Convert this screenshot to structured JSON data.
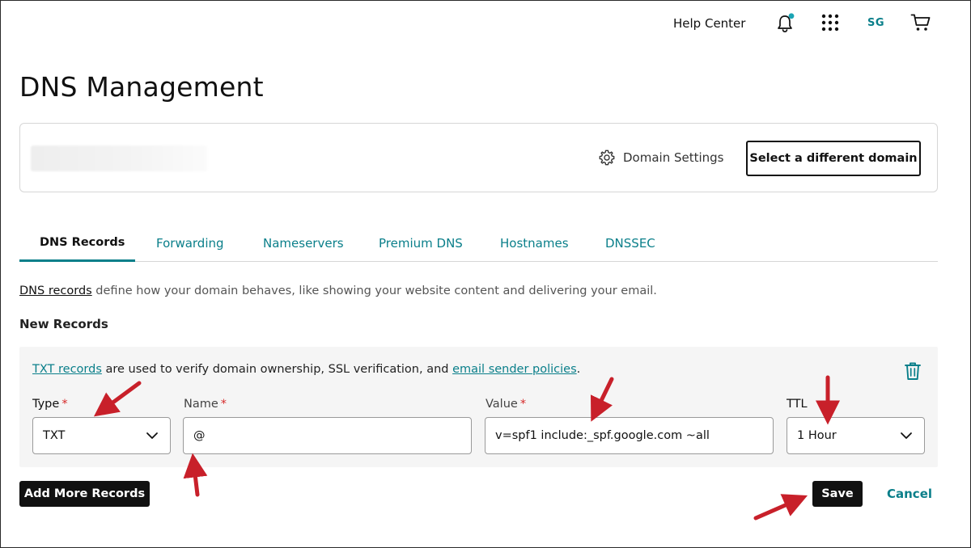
{
  "header": {
    "help_center": "Help Center",
    "user_initials": "SG",
    "icons": [
      "bell-icon",
      "apps-grid-icon",
      "cart-icon"
    ]
  },
  "page": {
    "title": "DNS Management"
  },
  "domain_card": {
    "domain_settings_label": "Domain Settings",
    "select_domain_label": "Select a different domain"
  },
  "tabs": [
    {
      "label": "DNS Records",
      "active": true
    },
    {
      "label": "Forwarding",
      "active": false
    },
    {
      "label": "Nameservers",
      "active": false
    },
    {
      "label": "Premium DNS",
      "active": false
    },
    {
      "label": "Hostnames",
      "active": false
    },
    {
      "label": "DNSSEC",
      "active": false
    }
  ],
  "description": {
    "link": "DNS records",
    "text": " define how your domain behaves, like showing your website content and delivering your email."
  },
  "new_records": {
    "heading": "New Records",
    "info_link1": "TXT records",
    "info_text": " are used to verify domain ownership, SSL verification, and ",
    "info_link2": "email sender policies",
    "info_end": ".",
    "required_mark": "*",
    "type_label": "Type",
    "type_value": "TXT",
    "name_label": "Name",
    "name_value": "@",
    "value_label": "Value",
    "value_value": "v=spf1 include:_spf.google.com ~all",
    "ttl_label": "TTL",
    "ttl_value": "1 Hour"
  },
  "actions": {
    "add_more": "Add More Records",
    "save": "Save",
    "cancel": "Cancel"
  },
  "colors": {
    "accent_teal": "#0a7f8a",
    "required_red": "#d62a2a",
    "annotation_arrow": "#c8202a",
    "notification_dot": "#1ba4b4"
  }
}
